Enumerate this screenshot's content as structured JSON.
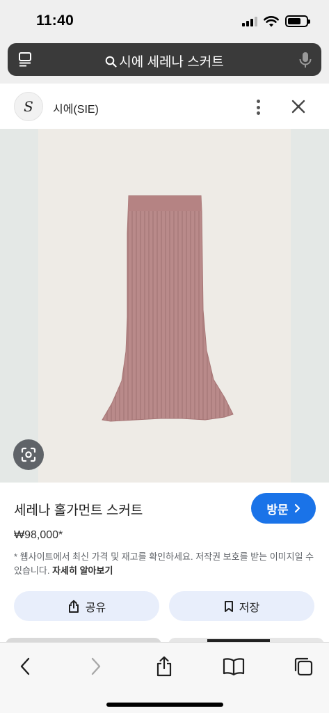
{
  "status_bar": {
    "time": "11:40",
    "battery_fraction": 0.72
  },
  "address_bar": {
    "query": "시에 세레나 스커트"
  },
  "source": {
    "logo_text": "S",
    "name": "시에(SIE)"
  },
  "product": {
    "title": "세레나 홀가먼트 스커트",
    "visit_label": "방문",
    "price": "₩98,000*",
    "disclaimer": "* 웹사이트에서 최신 가격 및 재고를 확인하세요. 저작권 보호를 받는 이미지일 수 있습니다.",
    "learn_more": "자세히 알아보기"
  },
  "actions": {
    "share_label": "공유",
    "save_label": "저장"
  },
  "toolbar": {
    "back": "chevron-left-icon",
    "forward": "chevron-right-icon",
    "share": "share-icon",
    "bookmarks": "book-icon",
    "tabs": "tabs-icon"
  },
  "colors": {
    "accent": "#1a73e8",
    "skirt": "#b98a8a",
    "chip_bg": "#e8eefb"
  }
}
